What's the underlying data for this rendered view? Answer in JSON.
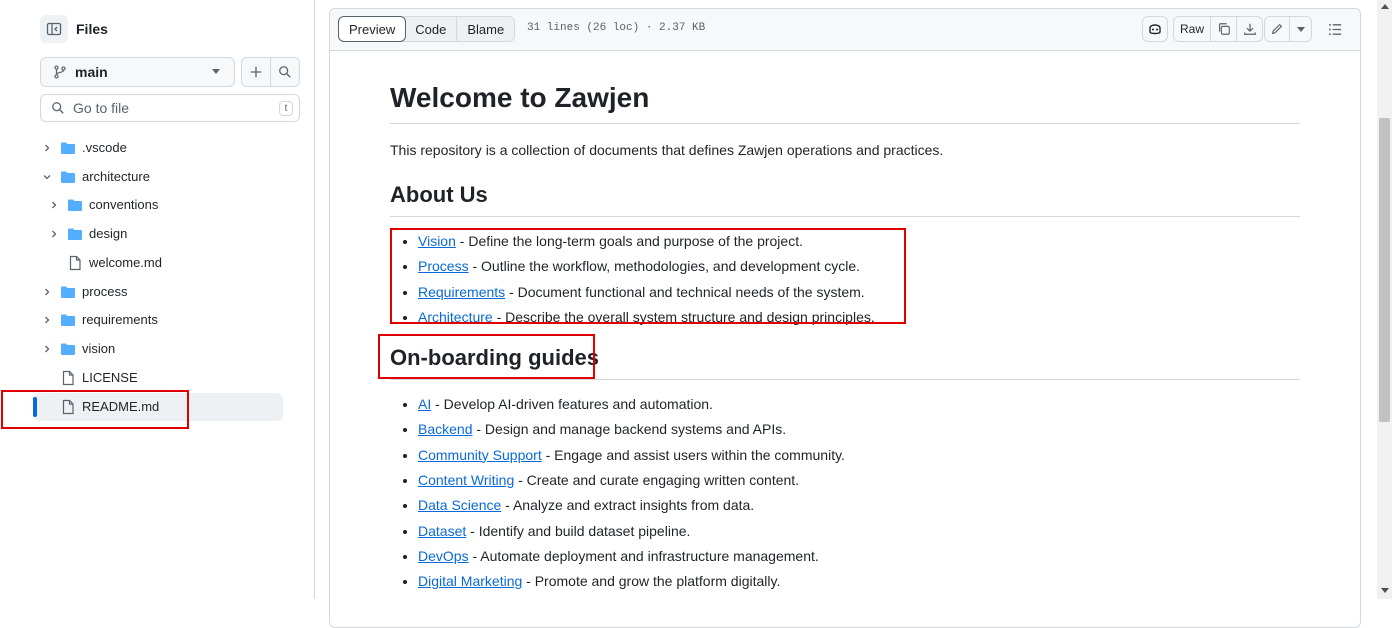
{
  "sidebar": {
    "title": "Files",
    "branch": "main",
    "search": {
      "placeholder": "Go to file",
      "shortcut": "t"
    },
    "tree": [
      {
        "label": ".vscode",
        "type": "folder",
        "expanded": false
      },
      {
        "label": "architecture",
        "type": "folder",
        "expanded": true
      },
      {
        "label": "conventions",
        "type": "folder",
        "expanded": false
      },
      {
        "label": "design",
        "type": "folder",
        "expanded": false
      },
      {
        "label": "welcome.md",
        "type": "file"
      },
      {
        "label": "process",
        "type": "folder",
        "expanded": false
      },
      {
        "label": "requirements",
        "type": "folder",
        "expanded": false
      },
      {
        "label": "vision",
        "type": "folder",
        "expanded": false
      },
      {
        "label": "LICENSE",
        "type": "file"
      },
      {
        "label": "README.md",
        "type": "file",
        "selected": true
      }
    ]
  },
  "toolbar": {
    "tabs": [
      "Preview",
      "Code",
      "Blame"
    ],
    "file_info": "31 lines (26 loc) · 2.37 KB",
    "raw_label": "Raw"
  },
  "doc": {
    "title": "Welcome to Zawjen",
    "intro": "This repository is a collection of documents that defines Zawjen operations and practices.",
    "about": {
      "heading": "About Us",
      "items": [
        {
          "link": "Vision",
          "text": " - Define the long-term goals and purpose of the project."
        },
        {
          "link": "Process",
          "text": " - Outline the workflow, methodologies, and development cycle."
        },
        {
          "link": "Requirements",
          "text": " - Document functional and technical needs of the system."
        },
        {
          "link": "Architecture",
          "text": " - Describe the overall system structure and design principles."
        }
      ]
    },
    "onboarding": {
      "heading": "On-boarding guides",
      "items": [
        {
          "link": "AI",
          "text": " - Develop AI-driven features and automation."
        },
        {
          "link": "Backend",
          "text": " - Design and manage backend systems and APIs."
        },
        {
          "link": "Community Support",
          "text": " - Engage and assist users within the community."
        },
        {
          "link": "Content Writing",
          "text": " - Create and curate engaging written content."
        },
        {
          "link": "Data Science",
          "text": " - Analyze and extract insights from data."
        },
        {
          "link": "Dataset",
          "text": " - Identify and build dataset pipeline."
        },
        {
          "link": "DevOps",
          "text": " - Automate deployment and infrastructure management."
        },
        {
          "link": "Digital Marketing",
          "text": " - Promote and grow the platform digitally."
        }
      ]
    }
  },
  "colors": {
    "accent": "#0969da",
    "folder": "#54aeff",
    "highlight": "#e00000"
  },
  "icons": [
    "sidebar-collapse-icon",
    "branch-icon",
    "plus-icon",
    "search-icon",
    "folder-icon",
    "file-icon",
    "copilot-icon",
    "copy-icon",
    "download-icon",
    "pencil-icon",
    "outline-icon"
  ]
}
